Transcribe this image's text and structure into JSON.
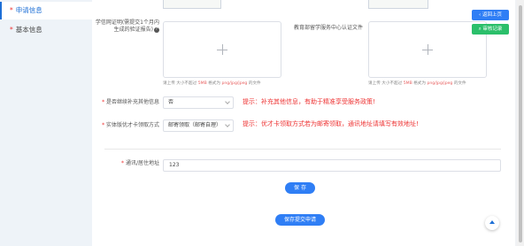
{
  "sidebar": {
    "items": [
      {
        "label": "申请信息",
        "required": "*",
        "active": true
      },
      {
        "label": "基本信息",
        "required": "*",
        "active": false
      }
    ]
  },
  "form": {
    "study_proof_label": "学信网证明(需提交1个月内生成的验证报告)",
    "edu_cert_label": "教育部留学服务中心认证文件",
    "upload_hint_prefix": "请上传 大小不超过",
    "upload_hint_size": "5MB",
    "upload_hint_mid": "格式为",
    "upload_hint_formats": "png/jpg/jpeg",
    "upload_hint_suffix": "的文件",
    "supplement_label": "是否继续补充其他信息",
    "supplement_value": "否",
    "supplement_tip": "提示：补充其他信息，有助于精准享受服务政策!",
    "delivery_label": "实体版优才卡领取方式",
    "delivery_value": "邮寄领取（邮寄自理）",
    "delivery_tip": "提示：优才卡领取方式若为邮寄领取，通讯地址请填写有效地址!",
    "address_label": "通讯/居住地址",
    "address_value": "123",
    "save_label": "保 存",
    "submit_label": "保存提交申请"
  },
  "floating": {
    "back_label": "返回上页",
    "audit_label": "审核记录",
    "back_color": "#2f7ef5",
    "audit_color": "#2bbf6a"
  },
  "icons": {
    "help": "question-circle-icon",
    "plus": "plus-icon",
    "chevron": "chevron-down-icon",
    "back": "chevron-left-icon",
    "audit": "search-icon",
    "top": "arrow-up-icon"
  },
  "colors": {
    "accent": "#2f7ef5",
    "tip": "#e33333",
    "required": "#e33333"
  }
}
